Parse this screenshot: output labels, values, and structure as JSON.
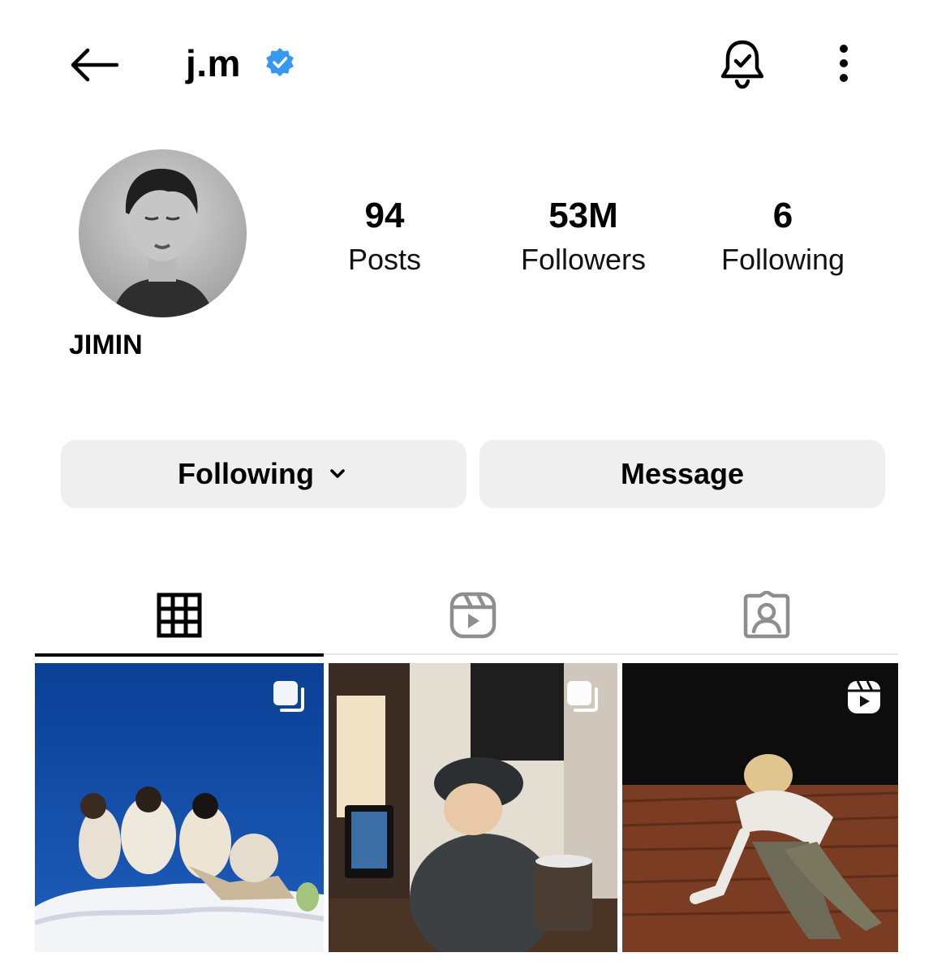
{
  "header": {
    "username": "j.m",
    "icons": {
      "back": "arrow-left-icon",
      "verified": "verified-badge-icon",
      "notifications": "bell-check-icon",
      "more": "more-vertical-icon"
    }
  },
  "profile": {
    "display_name": "JIMIN",
    "stats": [
      {
        "value": "94",
        "label": "Posts"
      },
      {
        "value": "53M",
        "label": "Followers"
      },
      {
        "value": "6",
        "label": "Following"
      }
    ]
  },
  "actions": {
    "following_label": "Following",
    "message_label": "Message"
  },
  "tabs": [
    {
      "icon": "grid-icon",
      "active": true
    },
    {
      "icon": "reels-icon",
      "active": false
    },
    {
      "icon": "tagged-icon",
      "active": false
    }
  ],
  "posts": [
    {
      "type": "carousel",
      "badge_icon": "carousel-icon"
    },
    {
      "type": "carousel",
      "badge_icon": "carousel-icon"
    },
    {
      "type": "reel",
      "badge_icon": "reel-icon"
    }
  ],
  "colors": {
    "verified": "#3897f0",
    "button_bg": "#efefef",
    "active_tab": "#000000",
    "inactive_tab": "#8e8e8e"
  }
}
